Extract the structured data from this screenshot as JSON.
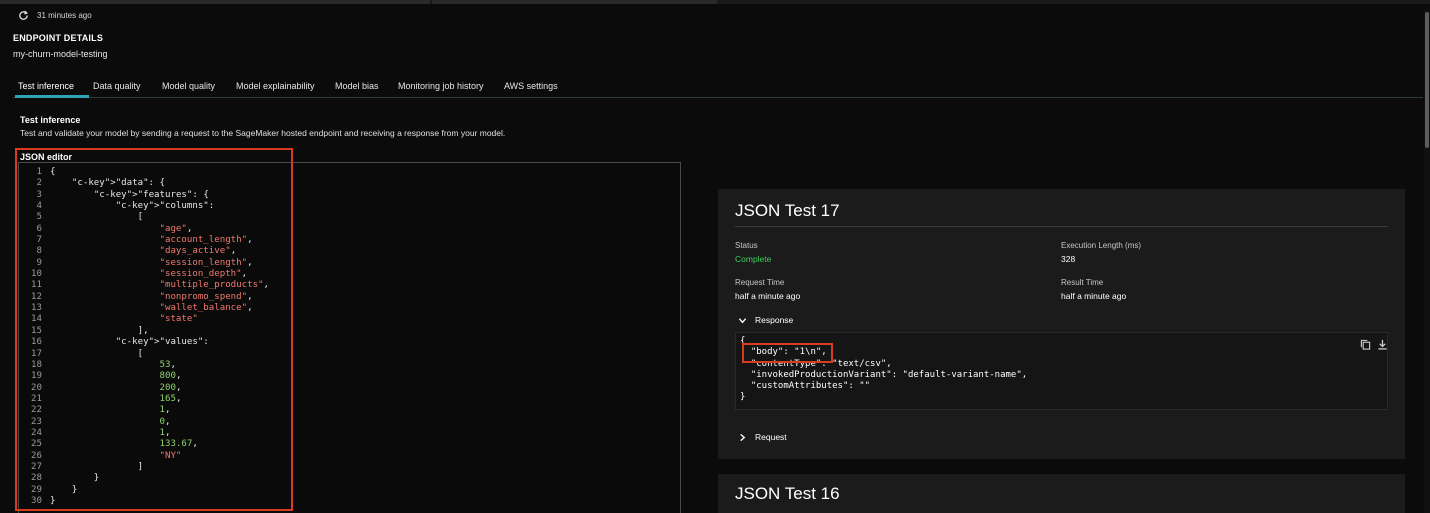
{
  "header": {
    "refresh_time": "31 minutes ago",
    "section_title": "ENDPOINT DETAILS",
    "endpoint_name": "my-churn-model-testing"
  },
  "tabs": [
    {
      "label": "Test inference",
      "active": true
    },
    {
      "label": "Data quality"
    },
    {
      "label": "Model quality"
    },
    {
      "label": "Model explainability"
    },
    {
      "label": "Model bias"
    },
    {
      "label": "Monitoring job history"
    },
    {
      "label": "AWS settings"
    }
  ],
  "test_inference": {
    "title": "Test inference",
    "description": "Test and validate your model by sending a request to the SageMaker hosted endpoint and receiving a response from your model."
  },
  "editor": {
    "label": "JSON editor",
    "lines": [
      "{",
      "    \"data\": {",
      "        \"features\": {",
      "            \"columns\":",
      "                [",
      "                    \"age\",",
      "                    \"account_length\",",
      "                    \"days_active\",",
      "                    \"session_length\",",
      "                    \"session_depth\",",
      "                    \"multiple_products\",",
      "                    \"nonpromo_spend\",",
      "                    \"wallet_balance\",",
      "                    \"state\"",
      "                ],",
      "            \"values\":",
      "                [",
      "                    53,",
      "                    800,",
      "                    200,",
      "                    165,",
      "                    1,",
      "                    0,",
      "                    1,",
      "                    133.67,",
      "                    \"NY\"",
      "                ]",
      "        }",
      "    }",
      "}"
    ]
  },
  "test17": {
    "title": "JSON Test 17",
    "status_label": "Status",
    "status_value": "Complete",
    "exec_label": "Execution Length (ms)",
    "exec_value": "328",
    "request_time_label": "Request Time",
    "request_time_value": "half a minute ago",
    "result_time_label": "Result Time",
    "result_time_value": "half a minute ago",
    "response_label": "Response",
    "response_lines": [
      "{",
      "  \"body\": \"1\\n\",",
      "  \"contentType\": \"text/csv\",",
      "  \"invokedProductionVariant\": \"default-variant-name\",",
      "  \"customAttributes\": \"\"",
      "}"
    ],
    "request_label": "Request"
  },
  "test16": {
    "title": "JSON Test 16"
  },
  "colors": {
    "accent": "#2ea5b5",
    "highlight_box": "#d93b1f",
    "status_ok": "#3ecf5c",
    "json_string": "#f07a6e",
    "json_number": "#8fd170"
  },
  "icons": [
    "refresh-icon",
    "chevron-down-icon",
    "chevron-right-icon",
    "copy-icon",
    "download-icon"
  ]
}
